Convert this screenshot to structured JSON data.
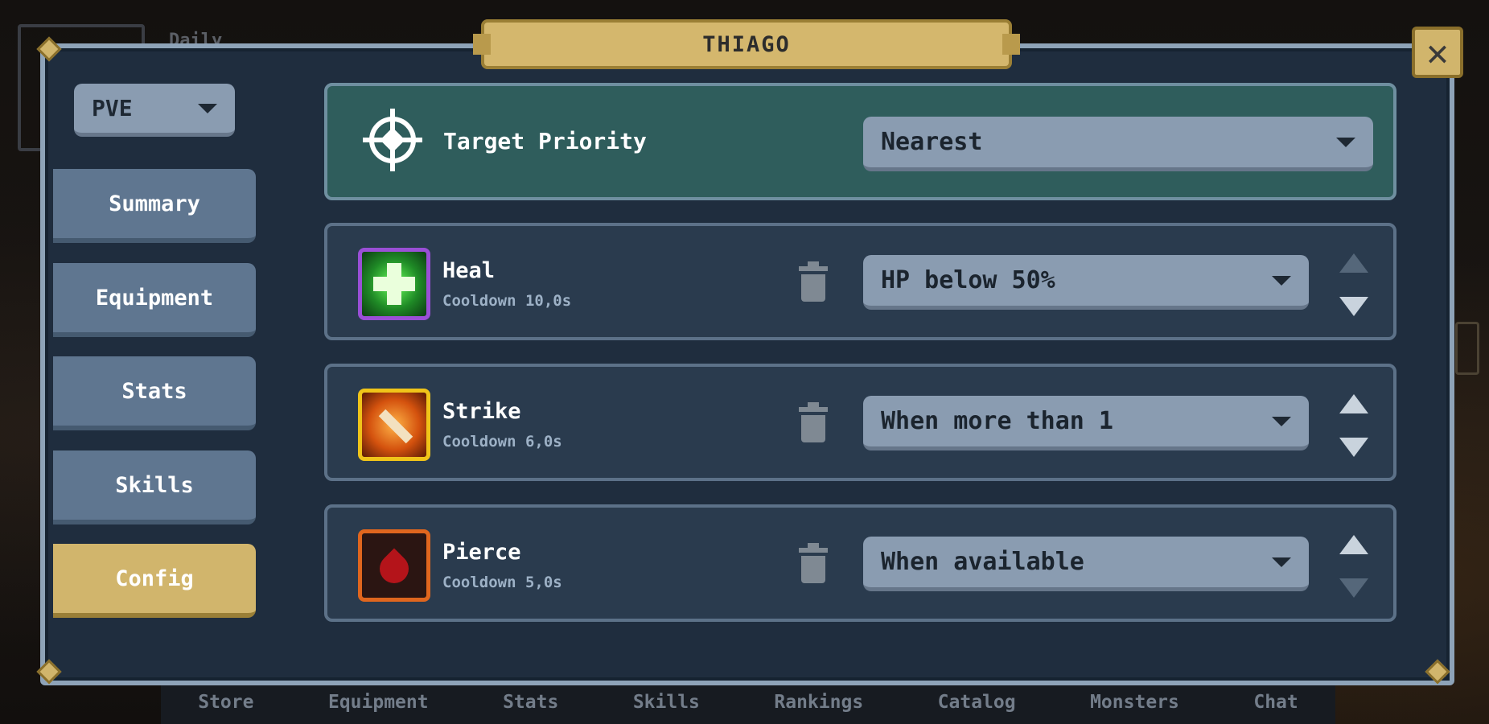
{
  "title": "THIAGO",
  "background": {
    "top_text": "Daily"
  },
  "mode_selector": {
    "value": "PVE"
  },
  "sidebar": {
    "items": [
      {
        "label": "Summary",
        "active": false
      },
      {
        "label": "Equipment",
        "active": false
      },
      {
        "label": "Stats",
        "active": false
      },
      {
        "label": "Skills",
        "active": false
      },
      {
        "label": "Config",
        "active": true
      }
    ]
  },
  "target_priority": {
    "label": "Target Priority",
    "value": "Nearest"
  },
  "skills": [
    {
      "name": "Heal",
      "cooldown": "Cooldown 10,0s",
      "condition": "HP below 50%",
      "icon": "heal-cross-icon",
      "border_color": "#9a4fd6",
      "up_enabled": false,
      "down_enabled": true
    },
    {
      "name": "Strike",
      "cooldown": "Cooldown 6,0s",
      "condition": "When more than 1",
      "icon": "strike-sword-icon",
      "border_color": "#f0c419",
      "up_enabled": true,
      "down_enabled": true
    },
    {
      "name": "Pierce",
      "cooldown": "Cooldown 5,0s",
      "condition": "When available",
      "icon": "blood-drop-icon",
      "border_color": "#e0661e",
      "up_enabled": true,
      "down_enabled": false
    }
  ],
  "bottom_nav": [
    "Store",
    "Equipment",
    "Stats",
    "Skills",
    "Rankings",
    "Catalog",
    "Monsters",
    "Chat"
  ],
  "colors": {
    "gold": "#d1b56c",
    "panel": "#1f2d3e",
    "teal": "#2f5d5c"
  }
}
